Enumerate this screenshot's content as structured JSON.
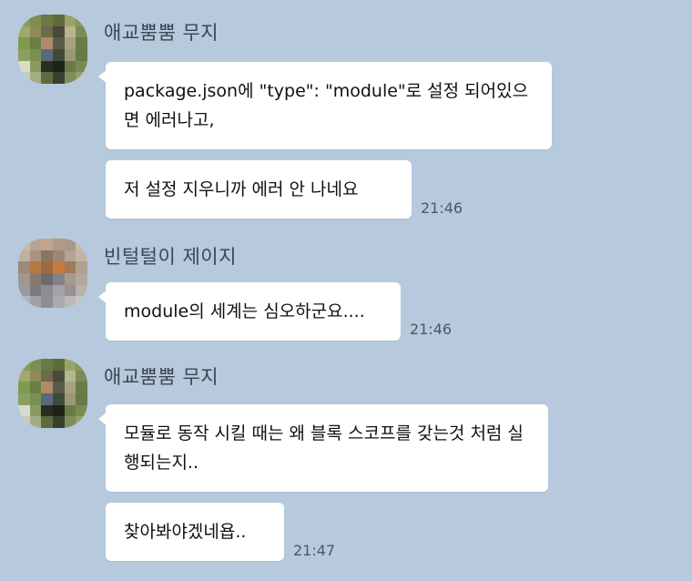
{
  "messages": [
    {
      "sender": "애교뿜뿜 무지",
      "bubbles": [
        {
          "text": "package.json에 \"type\": \"module\"로 설정 되어있으면 에러나고,",
          "time": ""
        },
        {
          "text": "저 설정 지우니까 에러 안 나네요",
          "time": "21:46"
        }
      ]
    },
    {
      "sender": "빈털털이 제이지",
      "bubbles": [
        {
          "text": "module의 세계는 심오하군요....",
          "time": "21:46"
        }
      ]
    },
    {
      "sender": "애교뿜뿜 무지",
      "bubbles": [
        {
          "text": "모듈로 동작 시킬 때는 왜 블록 스코프를 갖는것 처럼 실행되는지..",
          "time": ""
        },
        {
          "text": "찾아봐야겠네욥..",
          "time": "21:47"
        }
      ]
    }
  ],
  "colors": {
    "background": "#b6c9dd",
    "bubble": "#ffffff",
    "sender_text": "#3d4651",
    "time_text": "#4b5866"
  }
}
